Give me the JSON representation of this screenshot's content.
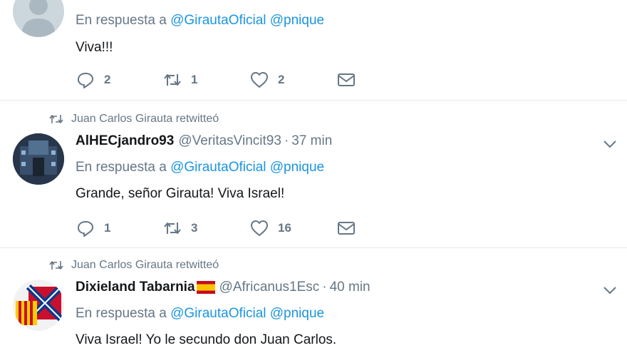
{
  "tweets": [
    {
      "retweeted_by": "",
      "name": "",
      "handle": "",
      "time": "",
      "reply_prefix": "En respuesta a",
      "reply_mentions": [
        "@GirautaOficial",
        "@pnique"
      ],
      "text": "Viva!!!",
      "counts": {
        "replies": "2",
        "retweets": "1",
        "likes": "2"
      }
    },
    {
      "retweeted_by": "Juan Carlos Girauta retwitteó",
      "name": "AlHECjandro93",
      "handle": "@VeritasVincit93",
      "time": "37 min",
      "reply_prefix": "En respuesta a",
      "reply_mentions": [
        "@GirautaOficial",
        "@pnique"
      ],
      "text": "Grande, señor Girauta! Viva Israel!",
      "counts": {
        "replies": "1",
        "retweets": "3",
        "likes": "16"
      }
    },
    {
      "retweeted_by": "Juan Carlos Girauta retwitteó",
      "name": "Dixieland Tabarnia",
      "handle": "@Africanus1Esc",
      "time": "40 min",
      "reply_prefix": "En respuesta a",
      "reply_mentions": [
        "@GirautaOficial",
        "@pnique"
      ],
      "text": "Viva Israel! Yo le secundo don Juan Carlos.",
      "counts": {
        "replies": "",
        "retweets": "",
        "likes": ""
      }
    }
  ],
  "icons": {
    "reply": "reply-icon",
    "retweet": "retweet-icon",
    "like": "heart-icon",
    "dm": "envelope-icon",
    "caret": "chevron-down-icon",
    "flag": "spain-flag-icon"
  },
  "colors": {
    "link": "#1b95e0",
    "secondary": "#657786",
    "text": "#14171a",
    "border": "#e1e8ed"
  }
}
